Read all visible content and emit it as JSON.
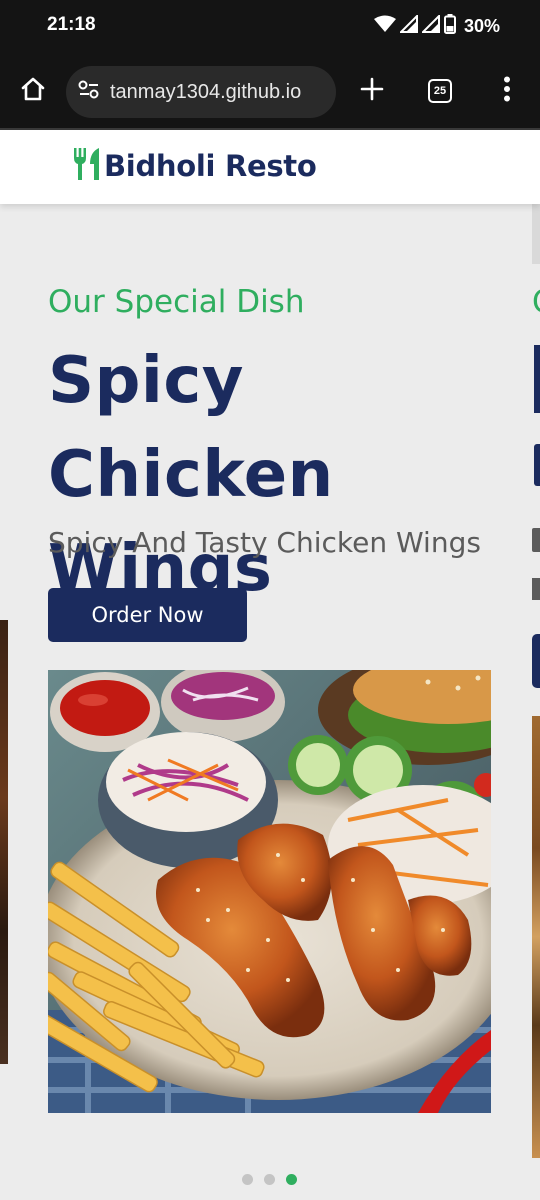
{
  "status_bar": {
    "time": "21:18",
    "battery": "30%",
    "icons": [
      "wifi-icon",
      "signal-icon",
      "signal-icon",
      "battery-icon"
    ]
  },
  "browser": {
    "url": "tanmay1304.github.io",
    "tab_count": "25",
    "icons": [
      "home-icon",
      "site-settings-icon",
      "new-tab-icon",
      "tabs-icon",
      "more-menu-icon"
    ]
  },
  "header": {
    "logo_icon": "fork-knife-icon",
    "site_name": "Bidholi Resto",
    "accent_color": "#2fae5f",
    "brand_color": "#1b2b5e"
  },
  "slide": {
    "kicker": "Our Special Dish",
    "title": "Spicy Chicken Wings",
    "subtitle": "Spicy And Tasty Chicken Wings",
    "button_label": "Order Now",
    "image_icon": "chicken-wings-dish-image"
  },
  "peek": {
    "kicker_letter": "O"
  },
  "pagination": {
    "total": 3,
    "active_index": 2
  }
}
